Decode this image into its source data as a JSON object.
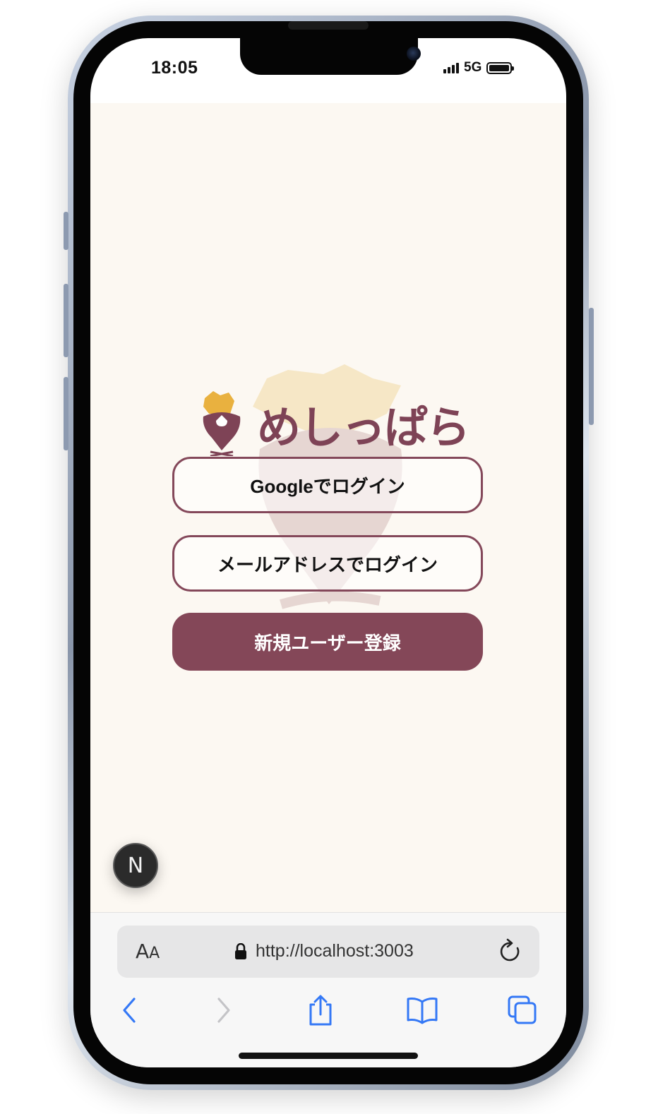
{
  "status_bar": {
    "time": "18:05",
    "network": "5G"
  },
  "app": {
    "logo_text": "めしっぱら",
    "logo_icon": "map-pin-onigiri-logo",
    "buttons": {
      "google_login": "Googleでログイン",
      "email_login": "メールアドレスでログイン",
      "register": "新規ユーザー登録"
    },
    "colors": {
      "brand": "#844758",
      "background": "#fcf8f2",
      "accent_yellow": "#e9b13f"
    }
  },
  "dev_badge": {
    "label": "N"
  },
  "safari": {
    "text_size_label_large": "A",
    "text_size_label_small": "A",
    "url": "http://localhost:3003",
    "icons": [
      "lock-icon",
      "reload-icon",
      "back-icon",
      "forward-icon",
      "share-icon",
      "bookmarks-icon",
      "tabs-icon"
    ]
  }
}
